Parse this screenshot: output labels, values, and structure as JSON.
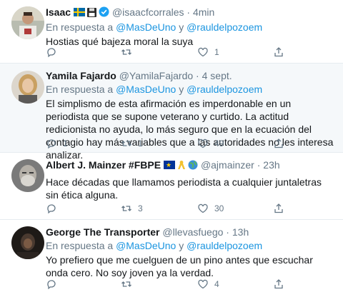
{
  "tweets": [
    {
      "name": "Isaac",
      "handle": "@isaacfcorrales",
      "time": "4min",
      "reply_prefix": "En respuesta a ",
      "reply_m1": "@MasDeUno",
      "reply_and": " y ",
      "reply_m2": "@rauldelpozoem",
      "text": "Hostias qué bajeza moral la suya",
      "replies": "",
      "retweets": "",
      "likes": "1",
      "badges": [
        "sweden-flag",
        "floppy-disk",
        "verified-badge"
      ]
    },
    {
      "name": "Yamila Fajardo",
      "handle": "@YamilaFajardo",
      "time": "4 sept.",
      "reply_prefix": "En respuesta a ",
      "reply_m1": "@MasDeUno",
      "reply_and": " y ",
      "reply_m2": "@rauldelpozoem",
      "text": "El simplismo de esta afirmación es imperdonable en un periodista que se supone veterano y curtido. La actitud redicionista no ayuda, lo más seguro que en la ecuación del contagio hay más variables que a las autoridades no les interesa analizar.",
      "replies": "1",
      "retweets": "1",
      "likes": "49"
    },
    {
      "name": "Albert J. Mainzer #FBPE",
      "handle": "@ajmainzer",
      "time": "23h",
      "text": "Hace décadas que llamamos periodista a cualquier juntaletras sin ética alguna.",
      "replies": "",
      "retweets": "3",
      "likes": "30",
      "badges": [
        "eu-flag",
        "yellow-ribbon",
        "globe-icon"
      ]
    },
    {
      "name": "George The Transporter",
      "handle": "@llevasfuego",
      "time": "13h",
      "reply_prefix": "En respuesta a ",
      "reply_m1": "@MasDeUno",
      "reply_and": " y ",
      "reply_m2": "@rauldelpozoem",
      "text": "Yo prefiero que me cuelguen de un pino antes que escuchar onda cero. No soy joven ya la verdad.",
      "replies": "",
      "retweets": "",
      "likes": "4"
    }
  ],
  "sep": " · ",
  "colors": {
    "link": "#1b95e0",
    "muted": "#657786",
    "like_active": "#e0245e"
  }
}
